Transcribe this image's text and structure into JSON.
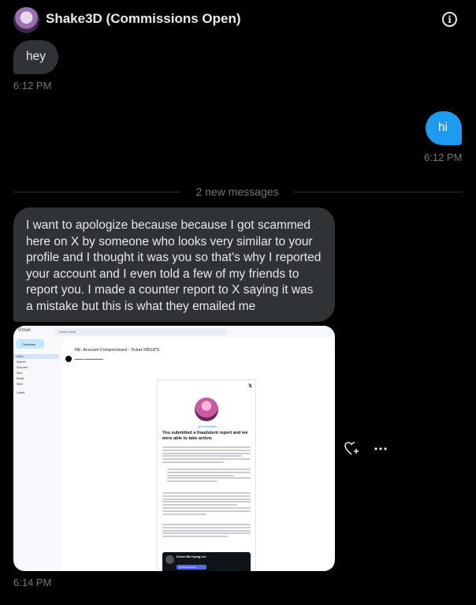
{
  "header": {
    "title": "Shake3D (Commissions Open)",
    "info_icon": "info-icon"
  },
  "messages": [
    {
      "direction": "incoming",
      "text": "hey"
    },
    {
      "direction": "outgoing",
      "text": "hi"
    }
  ],
  "timestamps": [
    "6:12 PM",
    "6:12 PM",
    "6:14 PM"
  ],
  "divider": {
    "label": "2 new messages"
  },
  "long_message": {
    "text": "I want to apologize because because I got scammed here on X by someone who looks very similar to your profile and I thought it was you so that's why I reported your account and I even told a few of my friends to report you. I made a counter report to X saying it was a mistake but this is what they emailed me"
  },
  "reaction_icons": [
    "add-reaction-icon",
    "more-icon"
  ],
  "screenshot": {
    "app": "Gmail",
    "search_placeholder": "Search mail",
    "compose": "Compose",
    "nav": [
      "Inbox",
      "Starred",
      "Snoozed",
      "Sent",
      "Drafts",
      "More"
    ],
    "labels_heading": "Labels",
    "subject": "RE: Account Compromised - Ticket #8518*5",
    "email_handle": "@TheDirtDen",
    "email_heading": "You submitted a fraudulent report and we were able to take action.",
    "contact_name": "Doctor Min Hyung Lee",
    "contact_button": "@drhyunsupport"
  },
  "colors": {
    "background": "#000000",
    "incoming_bubble": "#2f3336",
    "outgoing_bubble": "#1d9bf0",
    "muted_text": "#71767b"
  }
}
